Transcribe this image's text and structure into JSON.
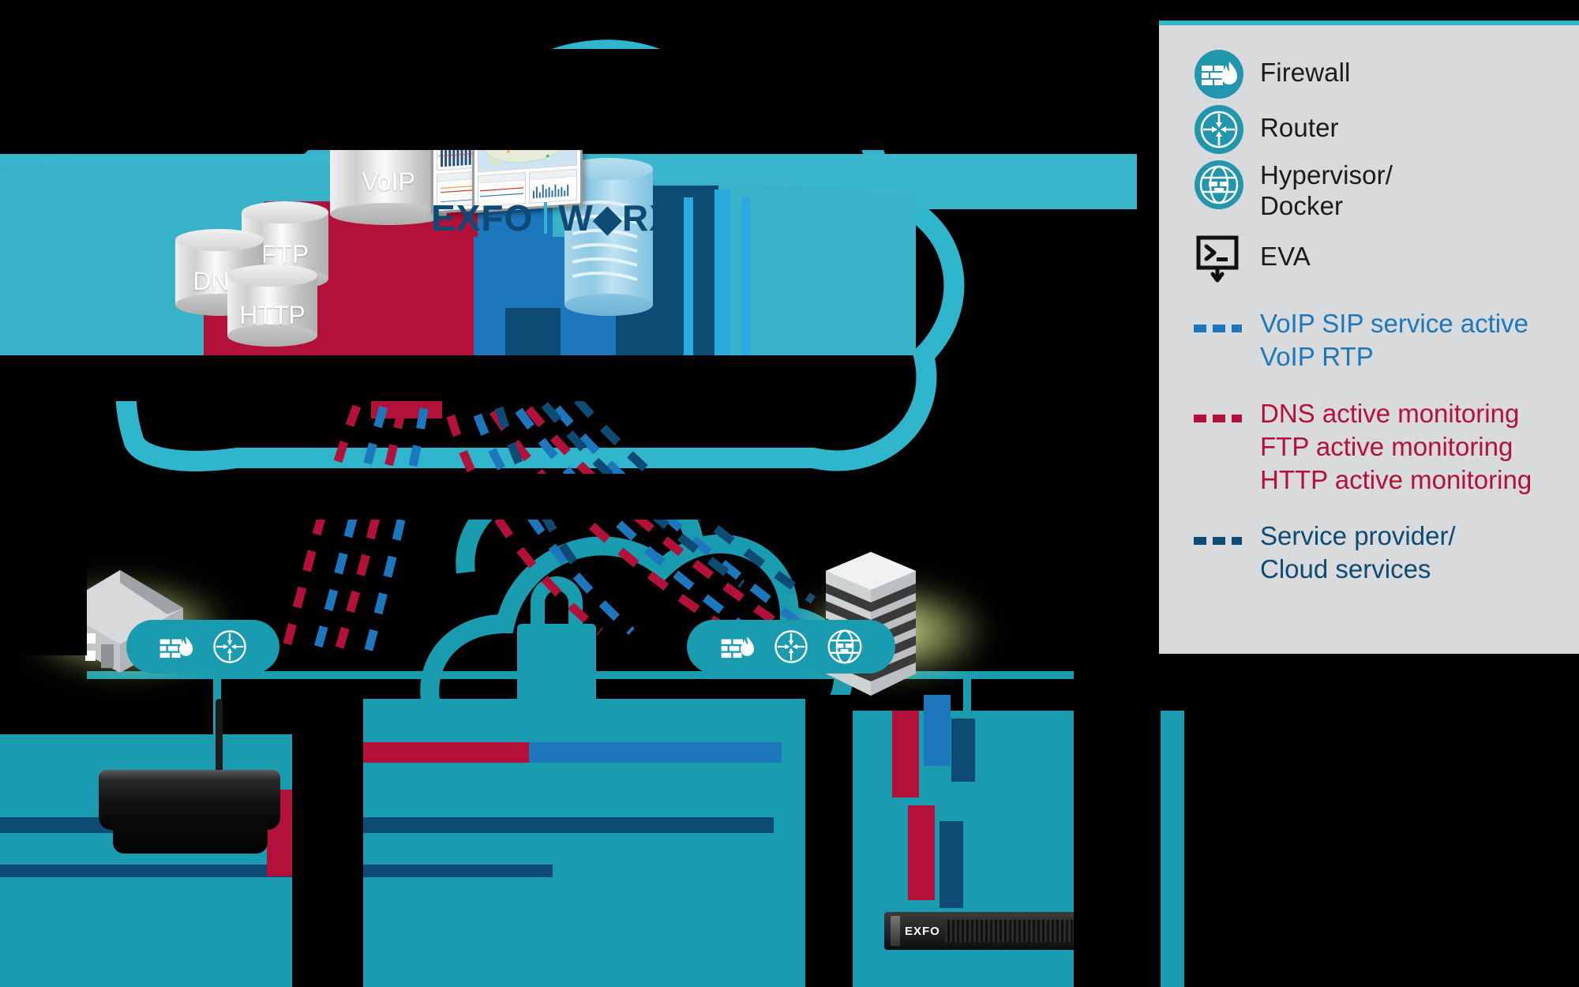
{
  "legend": {
    "items": [
      {
        "icon": "firewall-icon",
        "label": "Firewall",
        "multiline": false
      },
      {
        "icon": "router-icon",
        "label": "Router",
        "multiline": false
      },
      {
        "icon": "hypervisor-docker-icon",
        "label": "Hypervisor/\nDocker",
        "label_line1": "Hypervisor/",
        "label_line2": "Docker",
        "multiline": true
      },
      {
        "icon": "eva-terminal-icon",
        "label": "EVA",
        "multiline": false
      }
    ],
    "dashed": [
      {
        "swatch": "dashed-blue-swatch",
        "color": "#1c77bc",
        "lines": [
          "VoIP SIP service active",
          "VoIP RTP"
        ]
      },
      {
        "swatch": "dashed-red-swatch",
        "color": "#b4113a",
        "lines": [
          "DNS active monitoring",
          "FTP active monitoring",
          "HTTP active monitoring"
        ]
      },
      {
        "swatch": "dashed-navy-swatch",
        "color": "#0d4b74",
        "lines": [
          "Service provider/",
          "Cloud services"
        ]
      }
    ]
  },
  "diagram": {
    "cloud_servers": [
      {
        "id": "voip-db",
        "label": "VoIP"
      },
      {
        "id": "ftp-db",
        "label": "FTP"
      },
      {
        "id": "dns-db",
        "label": "DNS"
      },
      {
        "id": "http-db",
        "label": "HTTP"
      }
    ],
    "product_logo": {
      "brand": "EXFO",
      "product": "W◆RX",
      "full": "EXFO | WORX"
    },
    "sites": {
      "left": {
        "name": "residential-site",
        "device_label": ""
      },
      "right": {
        "name": "enterprise-site",
        "device_label": "EXFO"
      }
    },
    "colors": {
      "teal": "#1a9cb0",
      "teal_light": "#2fb6cd",
      "red": "#b4113a",
      "blue": "#1c77bc",
      "navy": "#0d4b74",
      "panel_bg": "#d9dadb",
      "background": "#000000"
    }
  }
}
